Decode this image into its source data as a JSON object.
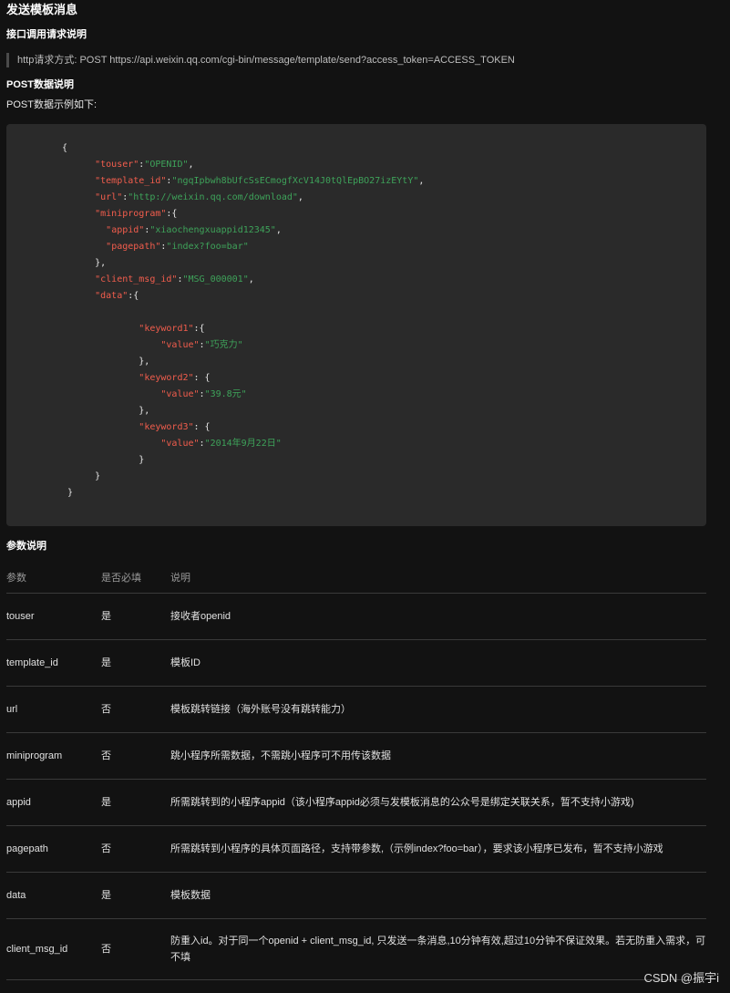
{
  "title": "发送模板消息",
  "api_heading": "接口调用请求说明",
  "api_url": "http请求方式: POST https://api.weixin.qq.com/cgi-bin/message/template/send?access_token=ACCESS_TOKEN",
  "post_heading": "POST数据说明",
  "post_intro": "POST数据示例如下:",
  "code": {
    "touser": "\"touser\"",
    "touser_v": "\"OPENID\"",
    "template_id": "\"template_id\"",
    "template_id_v": "\"ngqIpbwh8bUfcSsECmogfXcV14J0tQlEpBO27izEYtY\"",
    "url": "\"url\"",
    "url_v": "\"http://weixin.qq.com/download\"",
    "miniprogram": "\"miniprogram\"",
    "appid": "\"appid\"",
    "appid_v": "\"xiaochengxuappid12345\"",
    "pagepath": "\"pagepath\"",
    "pagepath_v": "\"index?foo=bar\"",
    "client_msg_id": "\"client_msg_id\"",
    "client_msg_id_v": "\"MSG_000001\"",
    "data": "\"data\"",
    "keyword1": "\"keyword1\"",
    "value1_k": "\"value\"",
    "value1_v": "\"巧克力\"",
    "keyword2": "\"keyword2\"",
    "value2_k": "\"value\"",
    "value2_v": "\"39.8元\"",
    "keyword3": "\"keyword3\"",
    "value3_k": "\"value\"",
    "value3_v": "\"2014年9月22日\""
  },
  "params_heading": "参数说明",
  "table": {
    "headers": [
      "参数",
      "是否必填",
      "说明"
    ],
    "rows": [
      [
        "touser",
        "是",
        "接收者openid"
      ],
      [
        "template_id",
        "是",
        "模板ID"
      ],
      [
        "url",
        "否",
        "模板跳转链接（海外账号没有跳转能力）"
      ],
      [
        "miniprogram",
        "否",
        "跳小程序所需数据，不需跳小程序可不用传该数据"
      ],
      [
        "appid",
        "是",
        "所需跳转到的小程序appid（该小程序appid必须与发模板消息的公众号是绑定关联关系，暂不支持小游戏)"
      ],
      [
        "pagepath",
        "否",
        "所需跳转到小程序的具体页面路径，支持带参数,（示例index?foo=bar），要求该小程序已发布，暂不支持小游戏"
      ],
      [
        "data",
        "是",
        "模板数据"
      ],
      [
        "client_msg_id",
        "否",
        "防重入id。对于同一个openid + client_msg_id, 只发送一条消息,10分钟有效,超过10分钟不保证效果。若无防重入需求，可不填"
      ]
    ]
  },
  "watermark": "CSDN @振宇i"
}
